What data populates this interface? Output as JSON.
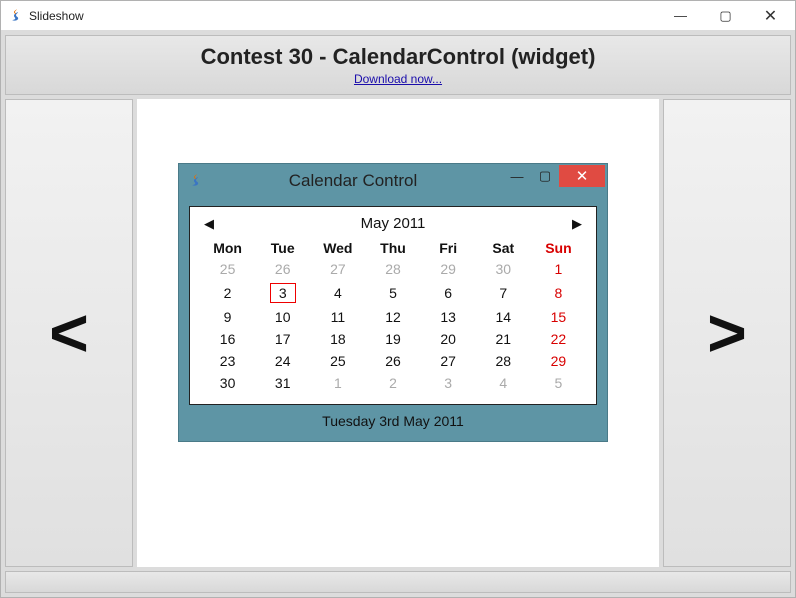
{
  "window_title": "Slideshow",
  "header": {
    "title": "Contest 30 - CalendarControl (widget)",
    "link": "Download now..."
  },
  "nav": {
    "prev": "<",
    "next": ">"
  },
  "inner": {
    "title": "Calendar Control",
    "month_label": "May 2011",
    "weekdays": [
      "Mon",
      "Tue",
      "Wed",
      "Thu",
      "Fri",
      "Sat",
      "Sun"
    ],
    "grid": [
      [
        {
          "d": "25",
          "other": true
        },
        {
          "d": "26",
          "other": true
        },
        {
          "d": "27",
          "other": true
        },
        {
          "d": "28",
          "other": true
        },
        {
          "d": "29",
          "other": true
        },
        {
          "d": "30",
          "other": true
        },
        {
          "d": "1",
          "sun": true
        }
      ],
      [
        {
          "d": "2"
        },
        {
          "d": "3",
          "selected": true
        },
        {
          "d": "4"
        },
        {
          "d": "5"
        },
        {
          "d": "6"
        },
        {
          "d": "7"
        },
        {
          "d": "8",
          "sun": true
        }
      ],
      [
        {
          "d": "9"
        },
        {
          "d": "10"
        },
        {
          "d": "11"
        },
        {
          "d": "12"
        },
        {
          "d": "13"
        },
        {
          "d": "14"
        },
        {
          "d": "15",
          "sun": true
        }
      ],
      [
        {
          "d": "16"
        },
        {
          "d": "17"
        },
        {
          "d": "18"
        },
        {
          "d": "19"
        },
        {
          "d": "20"
        },
        {
          "d": "21"
        },
        {
          "d": "22",
          "sun": true
        }
      ],
      [
        {
          "d": "23"
        },
        {
          "d": "24"
        },
        {
          "d": "25"
        },
        {
          "d": "26"
        },
        {
          "d": "27"
        },
        {
          "d": "28"
        },
        {
          "d": "29",
          "sun": true
        }
      ],
      [
        {
          "d": "30"
        },
        {
          "d": "31"
        },
        {
          "d": "1",
          "other": true
        },
        {
          "d": "2",
          "other": true
        },
        {
          "d": "3",
          "other": true
        },
        {
          "d": "4",
          "other": true
        },
        {
          "d": "5",
          "other": true,
          "sun": true
        }
      ]
    ],
    "selected_text": "Tuesday 3rd May 2011"
  },
  "icons": {
    "minimize": "—",
    "maximize": "▢",
    "close": "✕",
    "inner_minimize": "—",
    "inner_maximize": "▢",
    "inner_close": "✕",
    "cal_prev": "◀",
    "cal_next": "▶"
  }
}
